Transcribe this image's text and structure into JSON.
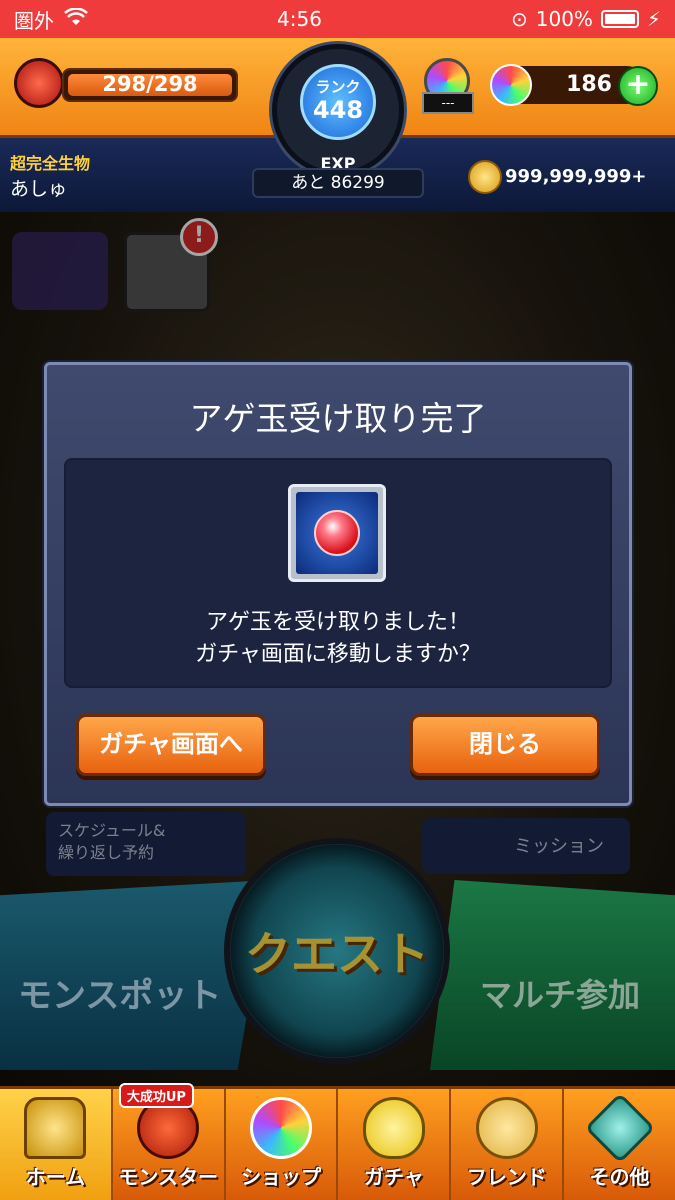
{
  "status_bar": {
    "carrier": "圏外",
    "time": "4:56",
    "battery": "100%"
  },
  "header": {
    "stamina": {
      "value": "298/298",
      "fill_fraction": 1.0
    },
    "rank": {
      "label": "ランク",
      "value": "448"
    },
    "exp": {
      "label": "EXP",
      "remaining": "あと 86299"
    },
    "stone_box": "---",
    "orbs": "186",
    "orb_plus": "+",
    "title": "超完全生物",
    "player_name": "あしゅ",
    "coins": "999,999,999+"
  },
  "hud": {
    "alert": "!"
  },
  "dialog": {
    "title": "アゲ玉受け取り完了",
    "message_line1": "アゲ玉を受け取りました！",
    "message_line2": "ガチャ画面に移動しますか？",
    "go_gacha_button": "ガチャ画面へ",
    "close_button": "閉じる"
  },
  "main": {
    "schedule_button": "スケジュール&\n繰り返し予約",
    "mission_button": "ミッション",
    "monspot_button": "モンスポット",
    "quest_button": "クエスト",
    "multi_button": "マルチ参加"
  },
  "bottom_nav": {
    "badge": "大成功UP",
    "items": [
      {
        "label": "ホーム",
        "icon": "home-icon"
      },
      {
        "label": "モンスター",
        "icon": "monster-icon"
      },
      {
        "label": "ショップ",
        "icon": "shop-icon"
      },
      {
        "label": "ガチャ",
        "icon": "gacha-icon"
      },
      {
        "label": "フレンド",
        "icon": "friend-icon"
      },
      {
        "label": "その他",
        "icon": "other-icon"
      }
    ]
  },
  "colors": {
    "status_bar": "#ef3b3b",
    "header_orange": "#f08414",
    "dialog_bg": "#3f4a6e",
    "button_orange": "#e8620e"
  }
}
